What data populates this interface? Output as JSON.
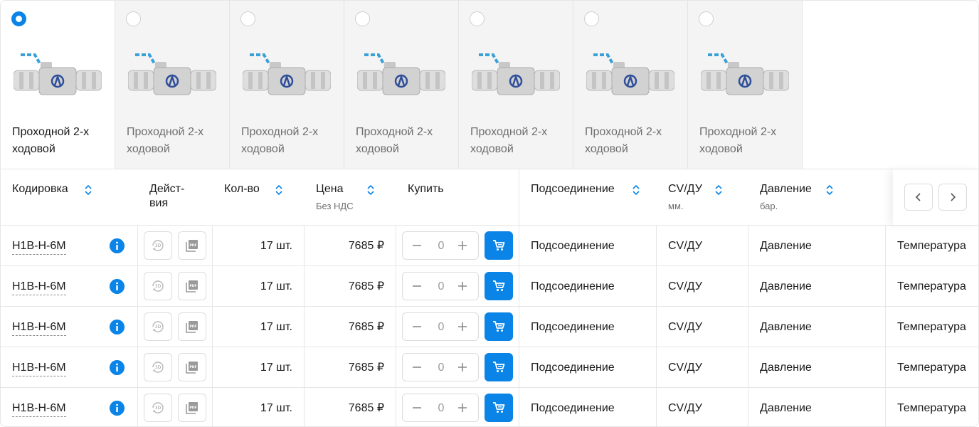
{
  "variants": [
    {
      "name": "Проходной 2-х ходовой",
      "selected": true
    },
    {
      "name": "Проходной 2-х ходовой",
      "selected": false
    },
    {
      "name": "Проходной 2-х ходовой",
      "selected": false
    },
    {
      "name": "Проходной 2-х ходовой",
      "selected": false
    },
    {
      "name": "Проходной 2-х ходовой",
      "selected": false
    },
    {
      "name": "Проходной 2-х ходовой",
      "selected": false
    },
    {
      "name": "Проходной 2-х ходовой",
      "selected": false
    }
  ],
  "table": {
    "headers": {
      "code": "Кодировка",
      "actions": "Дейст-\nвия",
      "qty": "Кол-во",
      "price": "Цена",
      "price_sub": "Без НДС",
      "buy": "Купить",
      "connection": "Подсоединение",
      "cv": "CV/ДУ",
      "cv_sub": "мм.",
      "pressure": "Давление",
      "pressure_sub": "бар."
    },
    "action_icons": [
      "3d-model-icon",
      "pdf-icon"
    ],
    "rows": [
      {
        "code": "H1B-H-6M",
        "qty": "17 шт.",
        "price": "7685 ₽",
        "count": "0",
        "connection": "Подсоединение",
        "cv": "CV/ДУ",
        "pressure": "Давление",
        "temperature": "Температура"
      },
      {
        "code": "H1B-H-6M",
        "qty": "17 шт.",
        "price": "7685 ₽",
        "count": "0",
        "connection": "Подсоединение",
        "cv": "CV/ДУ",
        "pressure": "Давление",
        "temperature": "Температура"
      },
      {
        "code": "H1B-H-6M",
        "qty": "17 шт.",
        "price": "7685 ₽",
        "count": "0",
        "connection": "Подсоединение",
        "cv": "CV/ДУ",
        "pressure": "Давление",
        "temperature": "Температура"
      },
      {
        "code": "H1B-H-6M",
        "qty": "17 шт.",
        "price": "7685 ₽",
        "count": "0",
        "connection": "Подсоединение",
        "cv": "CV/ДУ",
        "pressure": "Давление",
        "temperature": "Температура"
      },
      {
        "code": "H1B-H-6M",
        "qty": "17 шт.",
        "price": "7685 ₽",
        "count": "0",
        "connection": "Подсоединение",
        "cv": "CV/ДУ",
        "pressure": "Давление",
        "temperature": "Температура"
      }
    ]
  },
  "colors": {
    "accent": "#0a84e6",
    "border": "#e6e6e6",
    "card_bg": "#f4f4f4"
  }
}
